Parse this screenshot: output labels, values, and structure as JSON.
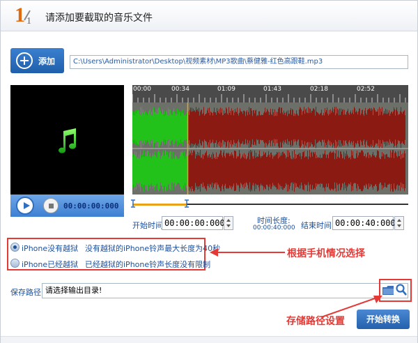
{
  "header": {
    "step_current": "1",
    "step_total": "1",
    "title": "请添加要截取的音乐文件"
  },
  "add_button": {
    "label": "添加"
  },
  "file_path": "C:\\Users\\Administrator\\Desktop\\视频素材\\MP3歌曲\\蔡健雅-红色高跟鞋.mp3",
  "player": {
    "time": "00:00:00:000"
  },
  "ruler": {
    "ticks": [
      "00:00",
      "00:34",
      "01:09",
      "01:43",
      "02:18",
      "02:52"
    ]
  },
  "trim": {
    "start_label": "开始时间:",
    "start_value": "00:00:00:000",
    "length_label": "时间长度:",
    "length_value": "00:00:40:000",
    "end_label": "结束时间:",
    "end_value": "00:00:40:000",
    "selection_end_fraction": 0.2
  },
  "options": [
    {
      "label": "iPhone没有越狱",
      "desc": "没有越狱的iPhone铃声最大长度为40秒",
      "selected": true
    },
    {
      "label": "iPhone已经越狱",
      "desc": "已经越狱的iPhone铃声长度没有限制",
      "selected": false
    }
  ],
  "annotations": {
    "phone_choice": "根据手机情况选择",
    "save_path": "存储路径设置"
  },
  "save": {
    "label": "保存路径:",
    "value": "请选择输出目录!"
  },
  "start_button": {
    "label": "开始转换"
  },
  "colors": {
    "accent": "#2f6fc2",
    "annotation": "#e53935",
    "wave_selected": "#22c21a",
    "wave_rest": "#8b1a12"
  }
}
